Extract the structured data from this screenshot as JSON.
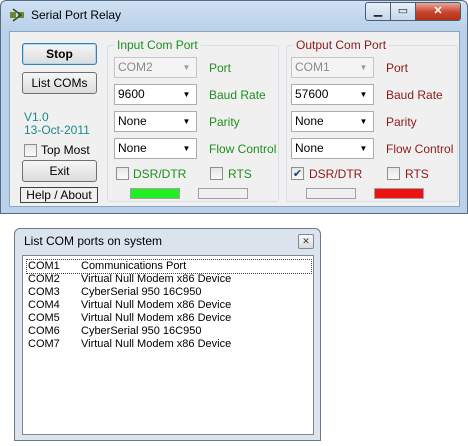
{
  "main_window": {
    "title": "Serial Port Relay",
    "stop_label": "Stop",
    "list_coms_label": "List COMs",
    "version": "V1.0",
    "date": "13-Oct-2011",
    "top_most_label": "Top Most",
    "exit_label": "Exit",
    "help_label": "Help / About"
  },
  "input_port": {
    "title": "Input Com Port",
    "port": "COM2",
    "port_label": "Port",
    "baud": "9600",
    "baud_label": "Baud Rate",
    "parity": "None",
    "parity_label": "Parity",
    "flow": "None",
    "flow_label": "Flow Control",
    "dsr_dtr_label": "DSR/DTR",
    "dsr_dtr_checked": false,
    "rts_label": "RTS",
    "rts_checked": false,
    "status_color": "#22ee22"
  },
  "output_port": {
    "title": "Output Com Port",
    "port": "COM1",
    "port_label": "Port",
    "baud": "57600",
    "baud_label": "Baud Rate",
    "parity": "None",
    "parity_label": "Parity",
    "flow": "None",
    "flow_label": "Flow Control",
    "dsr_dtr_label": "DSR/DTR",
    "dsr_dtr_checked": true,
    "rts_label": "RTS",
    "rts_checked": false,
    "status_color": "#ee1111"
  },
  "list_window": {
    "title": "List COM ports on system",
    "ports": [
      {
        "name": "COM1",
        "desc": "Communications Port"
      },
      {
        "name": "COM2",
        "desc": "Virtual Null Modem x86 Device"
      },
      {
        "name": "COM3",
        "desc": "CyberSerial 950 16C950"
      },
      {
        "name": "COM4",
        "desc": "Virtual Null Modem x86 Device"
      },
      {
        "name": "COM5",
        "desc": "Virtual Null Modem x86 Device"
      },
      {
        "name": "COM6",
        "desc": "CyberSerial 950 16C950"
      },
      {
        "name": "COM7",
        "desc": "Virtual Null Modem x86 Device"
      }
    ]
  },
  "icons": {
    "app": "serial-relay-icon",
    "minimize": "minimize-icon",
    "maximize": "maximize-icon",
    "close": "close-icon",
    "dropdown": "chevron-down-icon"
  }
}
